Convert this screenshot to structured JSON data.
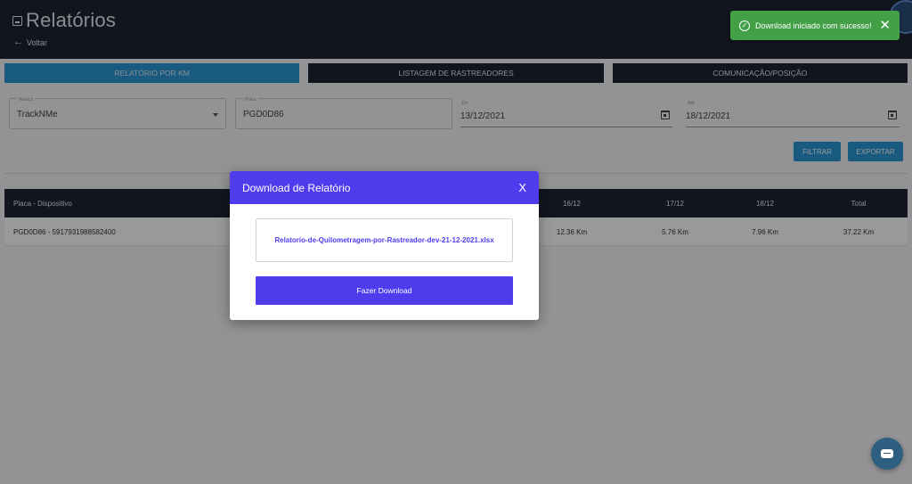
{
  "header": {
    "title": "Relatórios",
    "back_label": "Voltar"
  },
  "toast": {
    "message": "Download iniciado com sucesso!",
    "close": "✕"
  },
  "tabs": [
    {
      "label": "Relatório por KM",
      "active": true
    },
    {
      "label": "Listagem de Rastreadores",
      "active": false
    },
    {
      "label": "Comunicação/Posição",
      "active": false
    }
  ],
  "filters": {
    "alianca": {
      "label": "Aliança",
      "value": "TrackNMe"
    },
    "placa": {
      "label": "Placa",
      "value": "PGD0D86"
    },
    "de": {
      "label": "De",
      "value": "13/12/2021"
    },
    "ate": {
      "label": "Até",
      "value": "18/12/2021"
    }
  },
  "buttons": {
    "filtrar": "Filtrar",
    "exportar": "Exportar"
  },
  "table": {
    "headers": {
      "placa": "Placa - Dispositivo",
      "d16": "16/12",
      "d17": "17/12",
      "d18": "18/12",
      "total": "Total"
    },
    "rows": [
      {
        "placa": "PGD0D86 - 5917931988582400",
        "d16": "12.36 Km",
        "d17": "5.76 Km",
        "d18": "7.96 Km",
        "total": "37.22 Km"
      }
    ]
  },
  "modal": {
    "title": "Download de Relatório",
    "close": "X",
    "file_name": "Relatorio-de-Quilometragem-por-Rastreador-dev-21-12-2021.xlsx",
    "download_label": "Fazer Download"
  },
  "colors": {
    "header_bg": "#1c2333",
    "tab_active": "#2b97d6",
    "modal_accent": "#4f3cec",
    "toast_bg": "#43a047"
  }
}
